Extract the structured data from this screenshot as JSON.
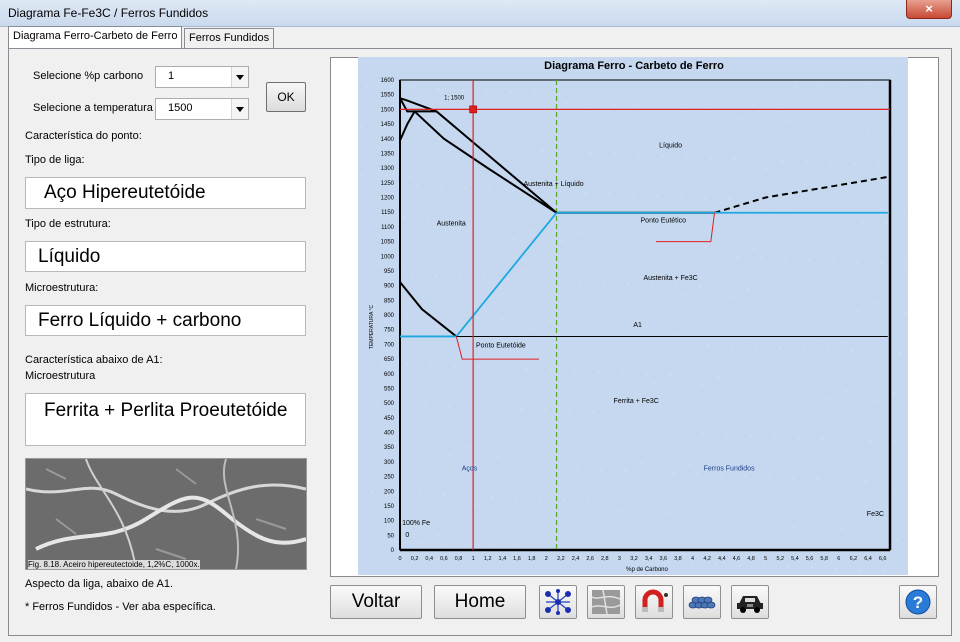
{
  "window": {
    "title": "Diagrama Fe-Fe3C / Ferros Fundidos",
    "close_label": "×"
  },
  "tabs": [
    {
      "label": "Diagrama Ferro-Carbeto de Ferro"
    },
    {
      "label": "Ferros Fundidos"
    }
  ],
  "form": {
    "carbon_label": "Selecione %p carbono",
    "carbon_value": "1",
    "temp_label": "Selecione a temperatura",
    "temp_value": "1500",
    "ok_label": "OK",
    "point_char_label": "Característica do ponto:",
    "alloy_type_label": "Tipo de liga:",
    "alloy_type_value": "Aço Hipereutetóide",
    "structure_type_label": "Tipo de estrutura:",
    "structure_type_value": "Líquido",
    "microstructure_label": "Microestrutura:",
    "microstructure_value": "Ferro Líquido + carbono",
    "below_a1_label": "Característica abaixo de A1:",
    "below_a1_micro_label": "Microestrutura",
    "below_a1_value": "Ferrita + Perlita Proeutetóide",
    "micro_caption": "Fig. 8.18. Aceiro hipereutectoide, 1,2%C, 1000x.",
    "aspect_label": "Aspecto da liga, abaixo de A1.",
    "footnote": "* Ferros Fundidos - Ver aba específica."
  },
  "buttons": {
    "back_label": "Voltar",
    "home_label": "Home",
    "icons": [
      "crystal-lattice-icon",
      "micrograph-icon",
      "magnet-icon",
      "pipes-icon",
      "car-icon",
      "help-icon"
    ],
    "help_label": "?"
  },
  "chart_data": {
    "type": "line",
    "title": "Diagrama Ferro - Carbeto de Ferro",
    "xlabel": "%p de Carbono",
    "ylabel": "TEMPERATURA °C",
    "xlim": [
      0,
      6.7
    ],
    "ylim": [
      0,
      1600
    ],
    "x_ticks": [
      "0",
      "0,2",
      "0,4",
      "0,6",
      "0,8",
      "1",
      "1,2",
      "1,4",
      "1,6",
      "1,8",
      "2",
      "2,2",
      "2,4",
      "2,6",
      "2,8",
      "3",
      "3,2",
      "3,4",
      "3,6",
      "3,8",
      "4",
      "4,2",
      "4,4",
      "4,6",
      "4,8",
      "5",
      "5,2",
      "5,4",
      "5,6",
      "5,8",
      "6",
      "6,2",
      "6,4",
      "6,6"
    ],
    "y_ticks": [
      0,
      50,
      100,
      150,
      200,
      250,
      300,
      350,
      400,
      450,
      500,
      550,
      600,
      650,
      700,
      750,
      800,
      850,
      900,
      950,
      1000,
      1050,
      1100,
      1150,
      1200,
      1250,
      1300,
      1350,
      1400,
      1450,
      1500,
      1550,
      1600
    ],
    "selected_point": {
      "x": 1,
      "y": 1500,
      "label": "1; 1500"
    },
    "eutectoid_temp": 727,
    "eutectic_temp": 1148,
    "series": [
      {
        "color": "#000000",
        "points": [
          [
            0,
            1538
          ],
          [
            0.1,
            1530
          ],
          [
            0.5,
            1493
          ],
          [
            2.14,
            1148
          ],
          [
            4.3,
            1148
          ]
        ]
      },
      {
        "color": "#000000",
        "points": [
          [
            0,
            1538
          ],
          [
            0.1,
            1493
          ],
          [
            0.5,
            1493
          ]
        ]
      },
      {
        "color": "#000000",
        "points": [
          [
            0,
            1394
          ],
          [
            0.1,
            1450
          ],
          [
            0.2,
            1493
          ]
        ]
      },
      {
        "color": "#000000",
        "points": [
          [
            0.2,
            1493
          ],
          [
            0.6,
            1400
          ],
          [
            1.2,
            1300
          ],
          [
            2.14,
            1148
          ]
        ]
      },
      {
        "color": "#000000",
        "points": [
          [
            0,
            912
          ],
          [
            0.3,
            820
          ],
          [
            0.77,
            727
          ]
        ]
      },
      {
        "color": "#000000",
        "dashed": true,
        "points": [
          [
            4.3,
            1148
          ],
          [
            5.0,
            1200
          ],
          [
            6.67,
            1270
          ]
        ]
      },
      {
        "color": "#1fa8e0",
        "points": [
          [
            0.77,
            727
          ],
          [
            2.14,
            1148
          ]
        ]
      },
      {
        "color": "#1fa8e0",
        "points": [
          [
            2.14,
            1148
          ],
          [
            6.67,
            1148
          ]
        ]
      },
      {
        "color": "#1fa8e0",
        "points": [
          [
            0,
            727
          ],
          [
            0.77,
            727
          ]
        ]
      },
      {
        "color": "#000000",
        "points": [
          [
            0.77,
            727
          ],
          [
            6.67,
            727
          ]
        ]
      }
    ],
    "region_labels": [
      {
        "text": "Líquido",
        "x": 3.7,
        "y": 1370
      },
      {
        "text": "Austenita + Líquido",
        "x": 2.1,
        "y": 1240
      },
      {
        "text": "Austenita",
        "x": 0.7,
        "y": 1105
      },
      {
        "text": "Ponto Eutético",
        "x": 3.6,
        "y": 1115
      },
      {
        "text": "Austenita + Fe3C",
        "x": 3.7,
        "y": 920
      },
      {
        "text": "A1",
        "x": 3.25,
        "y": 760
      },
      {
        "text": "Ponto Eutetóide",
        "x": 1.38,
        "y": 690
      },
      {
        "text": "Ferrita + Fe3C",
        "x": 3.23,
        "y": 500
      },
      {
        "text": "Aços",
        "x": 0.95,
        "y": 270
      },
      {
        "text": "Ferros Fundidos",
        "x": 4.5,
        "y": 270
      },
      {
        "text": "Fe3C",
        "x": 6.5,
        "y": 115
      },
      {
        "text": "100% Fe",
        "x": 0.22,
        "y": 85
      },
      {
        "text": "0",
        "x": 0.1,
        "y": 45
      }
    ]
  },
  "colors": {
    "plot_bg": "#c5d8ef",
    "selection": "#e02020",
    "green_marker": "#5aa82a",
    "phase_blue": "#1fa8e0"
  }
}
